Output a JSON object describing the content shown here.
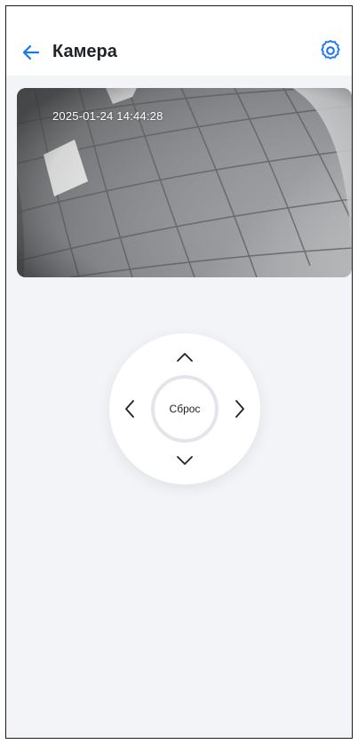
{
  "header": {
    "title": "Камера",
    "back_icon": "arrow-left-icon",
    "settings_icon": "gear-icon"
  },
  "camera": {
    "timestamp": "2025-01-24 14:44:28"
  },
  "controls": {
    "reset_label": "Сброс",
    "up_icon": "chevron-up-icon",
    "down_icon": "chevron-down-icon",
    "left_icon": "chevron-left-icon",
    "right_icon": "chevron-right-icon"
  },
  "colors": {
    "accent": "#1976f2",
    "background": "#f3f4f8"
  }
}
